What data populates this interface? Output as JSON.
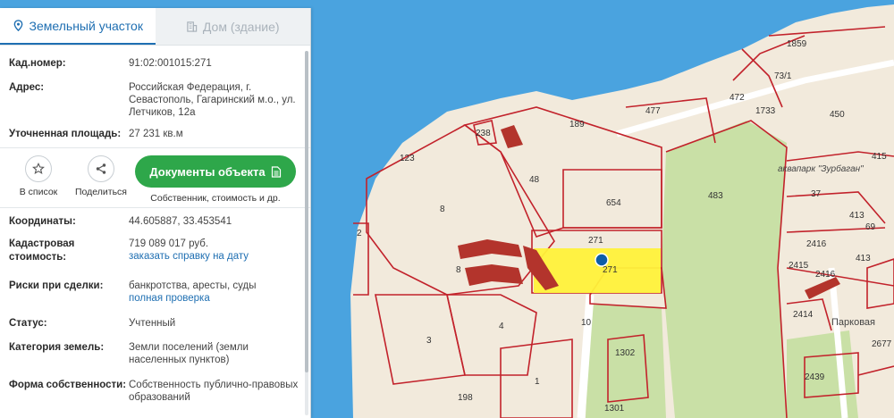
{
  "tabs": [
    {
      "label": "Земельный участок",
      "active": true
    },
    {
      "label": "Дом (здание)",
      "active": false
    }
  ],
  "fields": {
    "cad_label": "Кад.номер:",
    "cad_value": "91:02:001015:271",
    "addr_label": "Адрес:",
    "addr_value": "Российская Федерация, г. Севастополь, Гагаринский м.о., ул. Летчиков, 12а",
    "area_label": "Уточненная площадь:",
    "area_value": "27 231 кв.м",
    "coord_label": "Координаты:",
    "coord_value": "44.605887, 33.453541",
    "cost_label_1": "Кадастровая",
    "cost_label_2": "стоимость:",
    "cost_value": "719 089 017 руб.",
    "cost_link": "заказать справку на дату",
    "risk_label": "Риски при сделки:",
    "risk_value": "банкротства, аресты, суды",
    "risk_link": "полная проверка",
    "status_label": "Статус:",
    "status_value": "Учтенный",
    "cat_label": "Категория земель:",
    "cat_value": "Земли поселений (земли населенных пунктов)",
    "own_label": "Форма собственности:",
    "own_value": "Собственность публично-правовых образований"
  },
  "actions": {
    "favorite": "В список",
    "share": "Поделиться",
    "docs_button": "Документы объекта",
    "docs_sub": "Собственник, стоимость и др."
  },
  "map": {
    "parcel_labels": [
      "1859",
      "73/1",
      "477",
      "472",
      "1733",
      "450",
      "189",
      "238",
      "123",
      "48",
      "654",
      "483",
      "415",
      "8",
      "37",
      "413",
      "2",
      "271",
      "2416",
      "2415",
      "69",
      "271",
      "8",
      "2416",
      "413",
      "10",
      "4",
      "2414",
      "3",
      "1302",
      "2677",
      "198",
      "1",
      "2439",
      "1301"
    ],
    "street_labels": [
      "аквапарк \"Зурбаган\"",
      "Парковая"
    ],
    "colors": {
      "water": "#4aa3df",
      "land": "#f2eadc",
      "park": "#c9e0a6",
      "parcel": "#c2222b",
      "highlight": "#fff23a",
      "building": "#b3342c"
    }
  }
}
